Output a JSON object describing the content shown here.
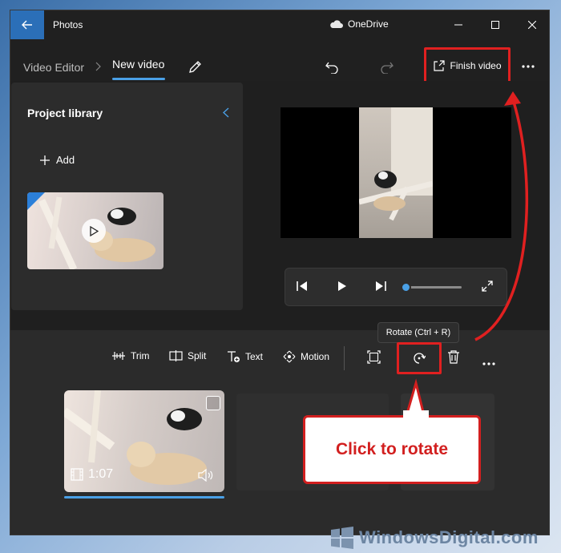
{
  "titlebar": {
    "app_title": "Photos",
    "cloud_label": "OneDrive",
    "back_icon": "arrow-left-icon",
    "controls": [
      "minimize-icon",
      "maximize-icon",
      "close-icon"
    ]
  },
  "header": {
    "breadcrumb_root": "Video Editor",
    "breadcrumb_current": "New video",
    "finish_label": "Finish video",
    "icons": [
      "edit-pencil-icon",
      "undo-icon",
      "redo-icon",
      "share-export-icon",
      "more-icon"
    ]
  },
  "library": {
    "title": "Project library",
    "add_label": "Add",
    "collapse_icon": "chevron-left-icon"
  },
  "player": {
    "controls": [
      "previous-frame-icon",
      "play-icon",
      "next-frame-icon",
      "fullscreen-icon"
    ],
    "progress": 0
  },
  "toolbar": {
    "trim": "Trim",
    "split": "Split",
    "text": "Text",
    "motion": "Motion",
    "tooltip": "Rotate (Ctrl + R)",
    "icons": [
      "trim-icon",
      "split-icon",
      "text-icon",
      "motion-icon",
      "crop-icon",
      "rotate-icon",
      "delete-icon",
      "more-icon"
    ]
  },
  "timeline": {
    "clip_duration": "1:07",
    "clip_icons": [
      "film-icon",
      "volume-icon"
    ]
  },
  "annotation": {
    "callout": "Click to rotate",
    "highlight_color": "#e02020"
  },
  "watermark": {
    "text": "WindowsDigital.com"
  },
  "colors": {
    "accent": "#4aa0e6",
    "back_button": "#2b6fb8",
    "window_bg": "#202020"
  }
}
